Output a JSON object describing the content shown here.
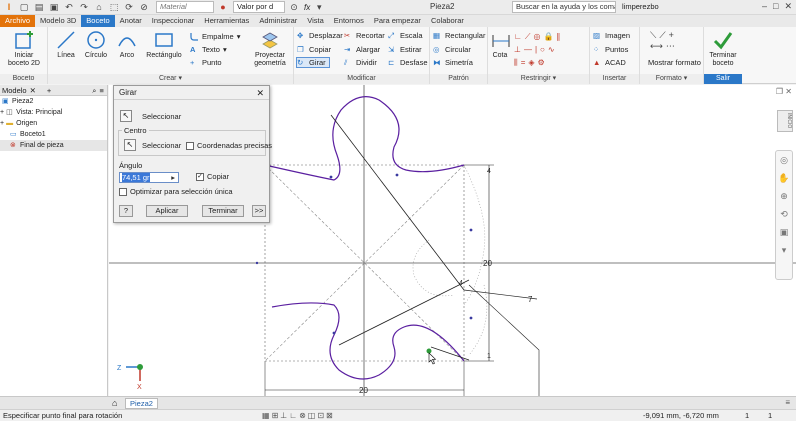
{
  "titlebar": {
    "material": "Material",
    "value": "Valor por d",
    "fx": "fx",
    "doc_title": "Pieza2",
    "search_placeholder": "Buscar en la ayuda y los comand",
    "user": "limperezbo"
  },
  "tabs": [
    {
      "label": "Archivo",
      "kind": "file"
    },
    {
      "label": "Modelo 3D",
      "kind": ""
    },
    {
      "label": "Boceto",
      "kind": "active"
    },
    {
      "label": "Anotar",
      "kind": ""
    },
    {
      "label": "Inspeccionar",
      "kind": ""
    },
    {
      "label": "Herramientas",
      "kind": ""
    },
    {
      "label": "Administrar",
      "kind": ""
    },
    {
      "label": "Vista",
      "kind": ""
    },
    {
      "label": "Entornos",
      "kind": ""
    },
    {
      "label": "Para empezar",
      "kind": ""
    },
    {
      "label": "Colaborar",
      "kind": ""
    }
  ],
  "ribbon": {
    "boceto": {
      "title": "Boceto",
      "iniciar_line1": "Iniciar",
      "iniciar_line2": "boceto 2D"
    },
    "crear": {
      "title": "Crear",
      "linea": "Línea",
      "circulo": "Círculo",
      "arco": "Arco",
      "rectangulo": "Rectángulo",
      "empalme": "Empalme",
      "texto": "Texto",
      "punto": "Punto",
      "proyectar_line1": "Proyectar",
      "proyectar_line2": "geometría"
    },
    "modificar": {
      "title": "Modificar",
      "desplazar": "Desplazar",
      "copiar": "Copiar",
      "girar": "Girar",
      "recortar": "Recortar",
      "alargar": "Alargar",
      "dividir": "Dividir",
      "escala": "Escala",
      "estirar": "Estirar",
      "desfase": "Desfase"
    },
    "patron": {
      "title": "Patrón",
      "rectangular": "Rectangular",
      "circular": "Circular",
      "simetria": "Simetría"
    },
    "restringir": {
      "title": "Restringir",
      "cota": "Cota"
    },
    "insertar": {
      "title": "Insertar",
      "imagen": "Imagen",
      "puntos": "Puntos",
      "acad": "ACAD"
    },
    "formato": {
      "title": "Formato",
      "mostrar": "Mostrar formato"
    },
    "salir": {
      "title": "Salir",
      "terminar_line1": "Terminar",
      "terminar_line2": "boceto"
    }
  },
  "browser": {
    "tab_label": "Modelo",
    "items": [
      {
        "label": "Pieza2",
        "icon": "part-icon",
        "indent": 2
      },
      {
        "label": "Vista: Principal",
        "icon": "view-icon",
        "indent": 5
      },
      {
        "label": "Origen",
        "icon": "folder-icon",
        "indent": 5
      },
      {
        "label": "Boceto1",
        "icon": "sketch-icon",
        "indent": 10
      },
      {
        "label": "Final de pieza",
        "icon": "end-of-part-icon",
        "indent": 10
      }
    ]
  },
  "dialog": {
    "title": "Girar",
    "seleccionar": "Seleccionar",
    "centro": "Centro",
    "centro_seleccionar": "Seleccionar",
    "coordenadas": "Coordenadas precisas",
    "angulo": "Ángulo",
    "angulo_value": "74,51 gr",
    "copiar": "Copiar",
    "optimizar": "Optimizar para selección única",
    "aplicar": "Aplicar",
    "terminar": "Terminar",
    "more": ">>"
  },
  "canvas": {
    "dim_height": "20",
    "dim_width": "20",
    "dim_tag_7": "7",
    "dim_tag_1": "1",
    "dim_tag_4": "4",
    "dim_tag_4b": "4",
    "axis_z": "Z",
    "axis_x": "X",
    "viewcube_label": "INICIO"
  },
  "doctabs": {
    "doc": "Pieza2"
  },
  "status": {
    "message": "Especificar punto final para rotación",
    "coords": "-9,091 mm, -6,720 mm",
    "n1": "1",
    "n2": "1"
  },
  "colors": {
    "accent": "#2b78c8",
    "file_tab": "#e3730a",
    "sketch_curve": "#5a1fa0",
    "dim_line": "#222222"
  }
}
